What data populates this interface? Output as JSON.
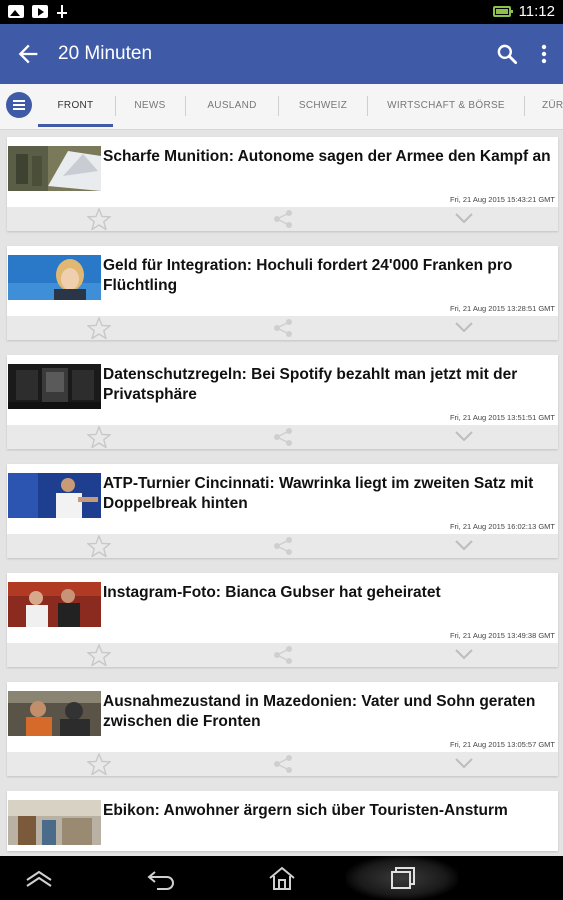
{
  "status": {
    "time": "11:12",
    "battery_color": "#8bc34a"
  },
  "appbar": {
    "title": "20 Minuten",
    "back_icon": "arrow-back-icon",
    "search_icon": "search-icon",
    "menu_icon": "more-vert-icon",
    "color": "#3f5ba8"
  },
  "tabs": [
    "FRONT",
    "NEWS",
    "AUSLAND",
    "SCHWEIZ",
    "WIRTSCHAFT & BÖRSE",
    "ZÜR"
  ],
  "articles": [
    {
      "title": "Scharfe Munition: Autonome sagen der Armee den Kampf an",
      "timestamp": "Fri, 21 Aug 2015 15:43:21 GMT"
    },
    {
      "title": "Geld für Integration: Hochuli fordert 24'000 Franken pro Flüchtling",
      "timestamp": "Fri, 21 Aug 2015 13:28:51 GMT"
    },
    {
      "title": "Datenschutzregeln: Bei Spotify bezahlt man jetzt mit der Privatsphäre",
      "timestamp": "Fri, 21 Aug 2015 13:51:51 GMT"
    },
    {
      "title": "ATP-Turnier Cincinnati: Wawrinka liegt im zweiten Satz mit Doppelbreak hinten",
      "timestamp": "Fri, 21 Aug 2015 16:02:13 GMT"
    },
    {
      "title": "Instagram-Foto: Bianca Gubser hat geheiratet",
      "timestamp": "Fri, 21 Aug 2015 13:49:38 GMT"
    },
    {
      "title": "Ausnahmezustand in Mazedonien: Vater und Sohn geraten zwischen die Fronten",
      "timestamp": "Fri, 21 Aug 2015 13:05:57 GMT"
    },
    {
      "title": "Ebikon: Anwohner ärgern sich über Touristen-Ansturm",
      "timestamp": ""
    }
  ]
}
